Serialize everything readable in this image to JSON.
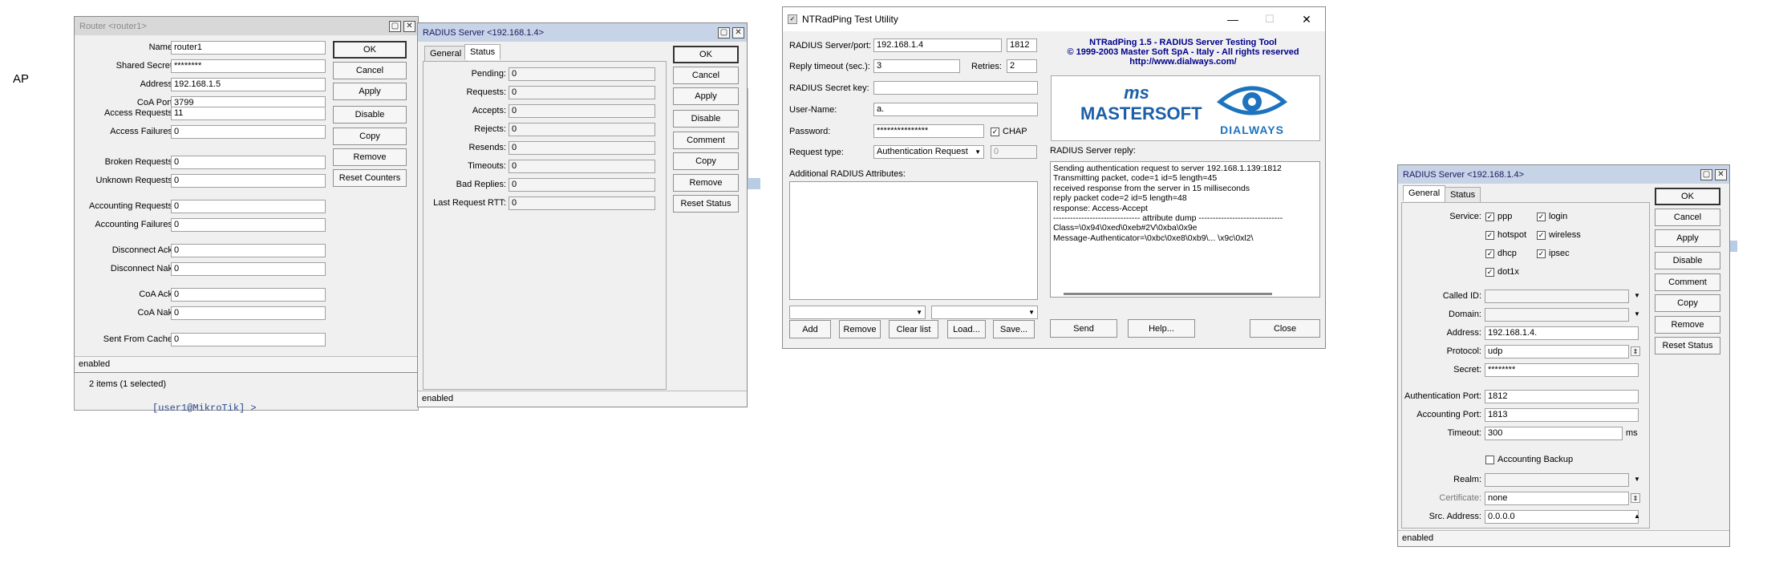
{
  "side_label": "AP",
  "terminal_prompt": "[user1@MikroTik] >",
  "router": {
    "title": "Router <router1>",
    "name_label": "Name:",
    "name": "router1",
    "secret_label": "Shared Secret:",
    "secret": "********",
    "address_label": "Address:",
    "address": "192.168.1.5",
    "coa_label": "CoA Port:",
    "coa": "3799",
    "fields": [
      {
        "label": "Access Requests:",
        "value": "11"
      },
      {
        "label": "Access Failures:",
        "value": "0"
      },
      {
        "label": "Broken Requests:",
        "value": "0"
      },
      {
        "label": "Unknown Requests:",
        "value": "0"
      },
      {
        "label": "Accounting Requests:",
        "value": "0"
      },
      {
        "label": "Accounting Failures:",
        "value": "0"
      },
      {
        "label": "Disconnect Ack:",
        "value": "0"
      },
      {
        "label": "Disconnect Nak:",
        "value": "0"
      },
      {
        "label": "CoA Ack:",
        "value": "0"
      },
      {
        "label": "CoA Nak:",
        "value": "0"
      },
      {
        "label": "Sent From Cache:",
        "value": "0"
      }
    ],
    "buttons": [
      "OK",
      "Cancel",
      "Apply",
      "Disable",
      "Copy",
      "Remove",
      "Reset Counters"
    ],
    "status": "enabled",
    "items_count": "2 items (1 selected)"
  },
  "radius_status": {
    "title": "RADIUS Server <192.168.1.4>",
    "tabs": [
      "General",
      "Status"
    ],
    "fields": [
      {
        "label": "Pending:",
        "value": "0"
      },
      {
        "label": "Requests:",
        "value": "0"
      },
      {
        "label": "Accepts:",
        "value": "0"
      },
      {
        "label": "Rejects:",
        "value": "0"
      },
      {
        "label": "Resends:",
        "value": "0"
      },
      {
        "label": "Timeouts:",
        "value": "0"
      },
      {
        "label": "Bad Replies:",
        "value": "0"
      },
      {
        "label": "Last Request RTT:",
        "value": "0"
      }
    ],
    "buttons": [
      "OK",
      "Cancel",
      "Apply",
      "Disable",
      "Comment",
      "Copy",
      "Remove",
      "Reset Status"
    ],
    "status": "enabled"
  },
  "ntrad": {
    "title": "NTRadPing Test Utility",
    "server_label": "RADIUS Server/port:",
    "server": "192.168.1.4",
    "port": "1812",
    "timeout_label": "Reply timeout (sec.):",
    "timeout": "3",
    "retries_label": "Retries:",
    "retries": "2",
    "secret_label": "RADIUS Secret key:",
    "secret": "",
    "user_label": "User-Name:",
    "user": "a.",
    "password_label": "Password:",
    "password": "***************",
    "chap_label": "CHAP",
    "reqtype_label": "Request type:",
    "reqtype": "Authentication Request",
    "reqnum": "0",
    "attrs_label": "Additional RADIUS Attributes:",
    "header_lines": [
      "NTRadPing 1.5 - RADIUS Server Testing Tool",
      "© 1999-2003 Master Soft SpA - Italy - All rights reserved",
      "http://www.dialways.com/"
    ],
    "logo_left": "MASTERSOFT",
    "logo_left_small": "ms",
    "logo_right": "DIALWAYS",
    "reply_label": "RADIUS Server reply:",
    "reply_lines": [
      "Sending authentication request to server 192.168.1.139:1812",
      "Transmitting packet, code=1 id=5 length=45",
      "received response from the server in 15 milliseconds",
      "reply packet code=2 id=5 length=48",
      "response: Access-Accept",
      "------------------------------- attribute dump ------------------------------",
      "Class=\\0x94\\0xed\\0xeb#2V\\0xba\\0x9e",
      "Message-Authenticator=\\0xbc\\0xe8\\0xb9\\...          \\x9c\\0xl2\\"
    ],
    "buttons": [
      "Add",
      "Remove",
      "Clear list",
      "Load...",
      "Save..."
    ],
    "send": "Send",
    "help": "Help...",
    "close": "Close"
  },
  "radius_general": {
    "title": "RADIUS Server <192.168.1.4>",
    "tabs": [
      "General",
      "Status"
    ],
    "service_label": "Service:",
    "services": [
      {
        "name": "ppp",
        "checked": true
      },
      {
        "name": "login",
        "checked": true
      },
      {
        "name": "hotspot",
        "checked": true
      },
      {
        "name": "wireless",
        "checked": true
      },
      {
        "name": "dhcp",
        "checked": true
      },
      {
        "name": "ipsec",
        "checked": true
      },
      {
        "name": "dot1x",
        "checked": true
      }
    ],
    "called_label": "Called ID:",
    "called": "",
    "domain_label": "Domain:",
    "domain": "",
    "address_label": "Address:",
    "address": "192.168.1.4.",
    "protocol_label": "Protocol:",
    "protocol": "udp",
    "secret_label": "Secret:",
    "secret": "********",
    "auth_label": "Authentication Port:",
    "auth": "1812",
    "acct_label": "Accounting Port:",
    "acct": "1813",
    "timeout_label": "Timeout:",
    "timeout": "300",
    "timeout_unit": "ms",
    "backup_label": "Accounting Backup",
    "realm_label": "Realm:",
    "realm": "",
    "cert_label": "Certificate:",
    "cert": "none",
    "src_label": "Src. Address:",
    "src": "0.0.0.0",
    "buttons": [
      "OK",
      "Cancel",
      "Apply",
      "Disable",
      "Comment",
      "Copy",
      "Remove",
      "Reset Status"
    ],
    "status": "enabled"
  }
}
